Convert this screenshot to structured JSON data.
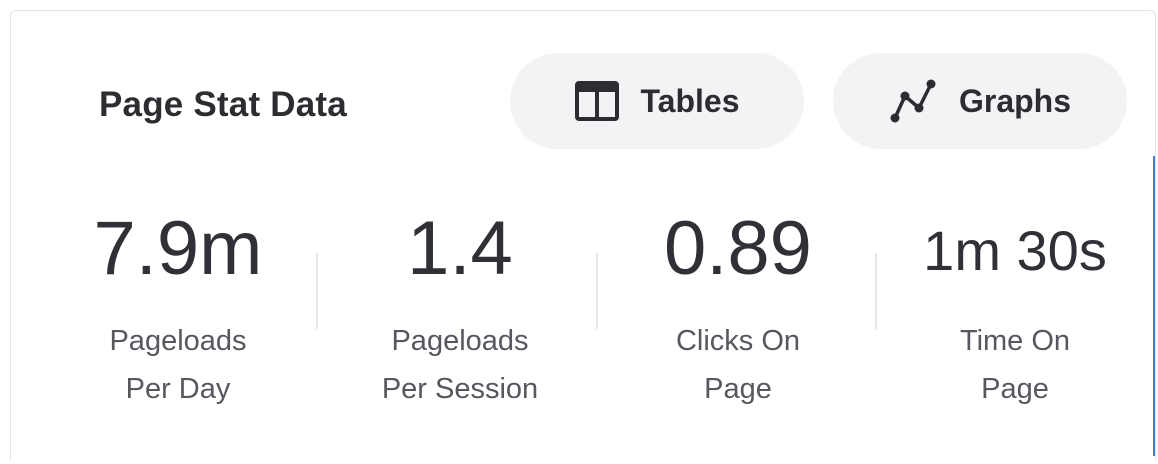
{
  "header": {
    "title": "Page Stat Data",
    "buttons": [
      {
        "label": "Tables",
        "icon": "table-icon"
      },
      {
        "label": "Graphs",
        "icon": "line-graph-icon"
      }
    ]
  },
  "stats": [
    {
      "value": "7.9m",
      "label_line1": "Pageloads",
      "label_line2": "Per Day"
    },
    {
      "value": "1.4",
      "label_line1": "Pageloads",
      "label_line2": "Per Session"
    },
    {
      "value": "0.89",
      "label_line1": "Clicks On",
      "label_line2": "Page"
    },
    {
      "value": "1m 30s",
      "label_line1": "Time On",
      "label_line2": "Page"
    }
  ],
  "colors": {
    "text_dark": "#2b2d31",
    "text_muted": "#55585e",
    "pill_bg": "#f2f3f5",
    "accent": "#4a7bd0"
  }
}
